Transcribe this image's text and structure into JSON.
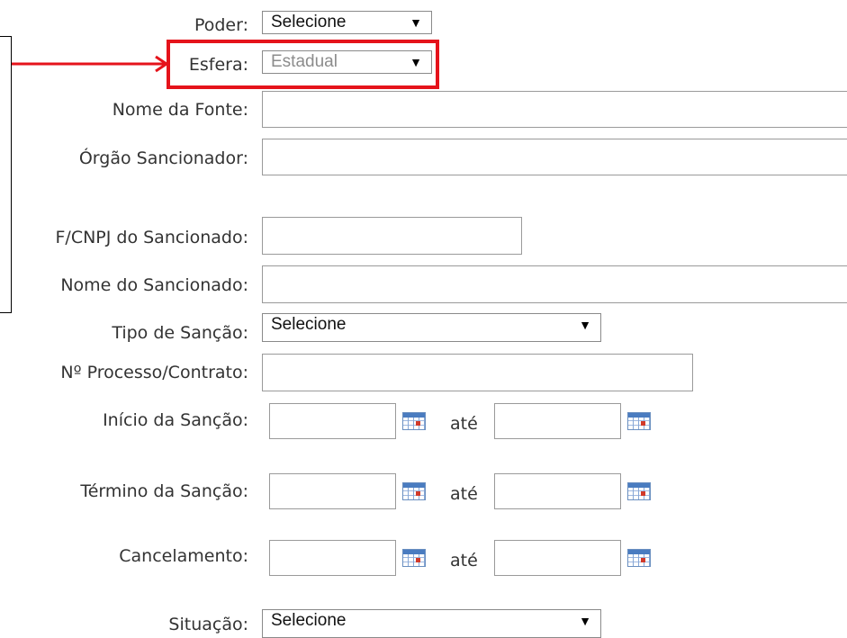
{
  "form": {
    "poder": {
      "label": "Poder:",
      "value": "Selecione"
    },
    "esfera": {
      "label": "Esfera:",
      "value": "Estadual"
    },
    "nome_fonte": {
      "label": "Nome da Fonte:"
    },
    "orgao": {
      "label": "Órgão Sancionador:"
    },
    "cpf_cnpj": {
      "label": "F/CNPJ do Sancionado:"
    },
    "nome_sancionado": {
      "label": "Nome do Sancionado:"
    },
    "tipo_sancao": {
      "label": "Tipo de Sanção:",
      "value": "Selecione"
    },
    "processo": {
      "label": "Nº Processo/Contrato:"
    },
    "inicio": {
      "label": "Início da Sanção:",
      "ate": "até"
    },
    "termino": {
      "label": "Término da Sanção:",
      "ate": "até"
    },
    "cancelamento": {
      "label": "Cancelamento:",
      "ate": "até"
    },
    "situacao": {
      "label": "Situação:",
      "value": "Selecione"
    }
  },
  "icons": {
    "dropdown": "triangle-down-icon",
    "calendar": "calendar-icon",
    "pointer": "arrow-right-icon"
  },
  "colors": {
    "highlight": "#e5131b",
    "label": "#333333",
    "disabled_text": "#8c8c8c"
  }
}
